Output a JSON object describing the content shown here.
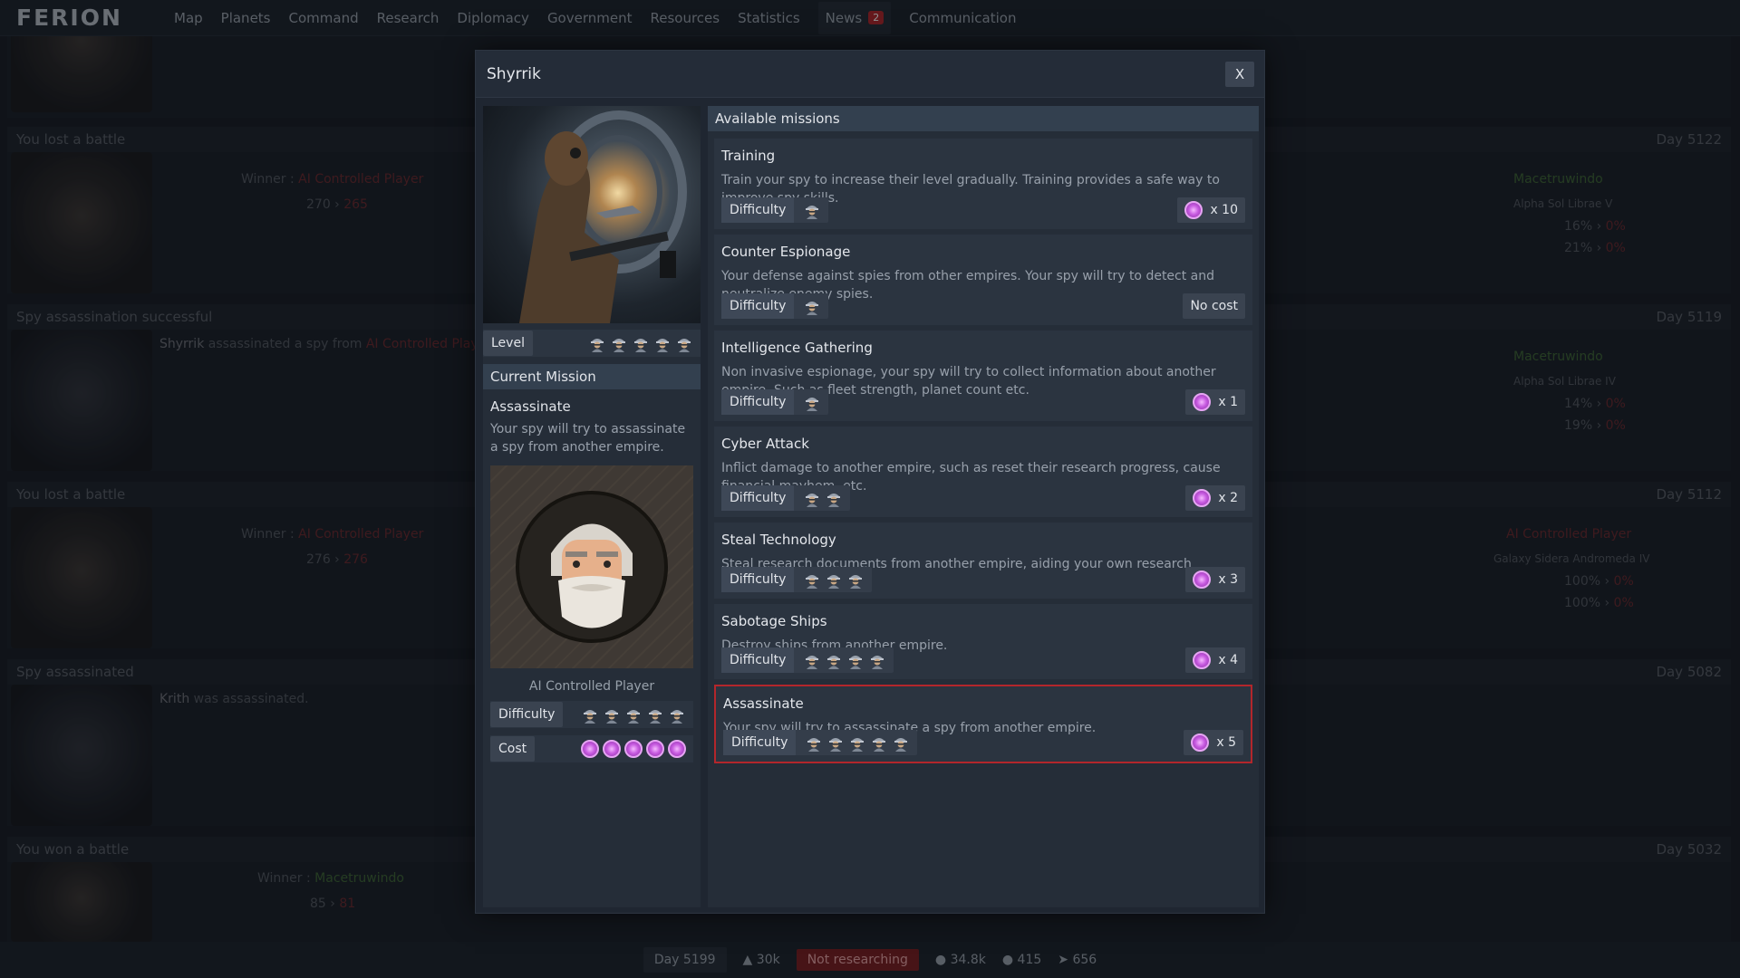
{
  "app": {
    "logo": "FERION"
  },
  "nav": [
    {
      "label": "Map"
    },
    {
      "label": "Planets"
    },
    {
      "label": "Command"
    },
    {
      "label": "Research"
    },
    {
      "label": "Diplomacy"
    },
    {
      "label": "Government"
    },
    {
      "label": "Resources"
    },
    {
      "label": "Statistics"
    },
    {
      "label": "News",
      "badge": "2"
    },
    {
      "label": "Communication"
    }
  ],
  "feed": [
    {
      "header": "You lost a battle",
      "day": "Day 5122",
      "winner_label": "Winner : ",
      "winner": "AI Controlled Player",
      "ships_from": "270",
      "ships_to": "265",
      "right_player": "Macetruwindo",
      "location": "Alpha Sol Librae V",
      "pct1": "16%",
      "pct1b": "0%",
      "pct2": "21%",
      "pct2b": "0%"
    },
    {
      "header": "Spy assassination successful",
      "day": "Day 5119",
      "actor": "Shyrrik",
      "verb": " assassinated a spy from ",
      "target": "AI Controlled Player.",
      "right_player": "Macetruwindo",
      "location": "Alpha Sol Librae IV",
      "pct1": "14%",
      "pct1b": "0%",
      "pct2": "19%",
      "pct2b": "0%"
    },
    {
      "header": "You lost a battle",
      "day": "Day 5112",
      "winner_label": "Winner : ",
      "winner": "AI Controlled Player",
      "ships_from": "276",
      "ships_to": "276",
      "right_player": "AI Controlled Player",
      "location": "Galaxy Sidera Andromeda IV",
      "pct1": "100%",
      "pct1b": "0%",
      "pct2": "100%",
      "pct2b": "0%"
    },
    {
      "header": "Spy assassinated",
      "day": "Day 5082",
      "actor": "Krith",
      "verb": " was assassinated."
    },
    {
      "header": "You won a battle",
      "day": "Day 5032",
      "winner_label": "Winner : ",
      "winner": "Macetruwindo",
      "ships_from": "85",
      "ships_to": "81"
    }
  ],
  "modal": {
    "title": "Shyrrik",
    "close_label": "X",
    "level_label": "Level",
    "level": 5,
    "current_mission_heading": "Current Mission",
    "current_mission": {
      "title": "Assassinate",
      "desc": "Your spy will try to assassinate a spy from another empire.",
      "target": "AI Controlled Player",
      "difficulty_label": "Difficulty",
      "difficulty": 5,
      "cost_label": "Cost",
      "cost": 5
    },
    "missions_heading": "Available missions",
    "missions": [
      {
        "title": "Training",
        "desc": "Train your spy to increase their level gradually. Training provides a safe way to improve spy skills.",
        "difficulty_label": "Difficulty",
        "difficulty": 1,
        "cost": "x 10",
        "has_coin": true
      },
      {
        "title": "Counter Espionage",
        "desc": "Your defense against spies from other empires. Your spy will try to detect and neutralize enemy spies.",
        "difficulty_label": "Difficulty",
        "difficulty": 1,
        "cost": "No cost",
        "has_coin": false
      },
      {
        "title": "Intelligence Gathering",
        "desc": "Non invasive espionage, your spy will try to collect information about another empire. Such as fleet strength, planet count etc.",
        "difficulty_label": "Difficulty",
        "difficulty": 1,
        "cost": "x 1",
        "has_coin": true
      },
      {
        "title": "Cyber Attack",
        "desc": "Inflict damage to another empire, such as reset their research progress, cause financial mayhem, etc.",
        "difficulty_label": "Difficulty",
        "difficulty": 2,
        "cost": "x 2",
        "has_coin": true
      },
      {
        "title": "Steal Technology",
        "desc": "Steal research documents from another empire, aiding your own research progress.",
        "difficulty_label": "Difficulty",
        "difficulty": 3,
        "cost": "x 3",
        "has_coin": true
      },
      {
        "title": "Sabotage Ships",
        "desc": "Destroy ships from another empire.",
        "difficulty_label": "Difficulty",
        "difficulty": 4,
        "cost": "x 4",
        "has_coin": true
      },
      {
        "title": "Assassinate",
        "desc": "Your spy will try to assassinate a spy from another empire.",
        "difficulty_label": "Difficulty",
        "difficulty": 5,
        "cost": "x 5",
        "has_coin": true,
        "selected": true
      }
    ]
  },
  "bottombar": {
    "day": "Day 5199",
    "population": "30k",
    "research": "Not researching",
    "credits": "34.8k",
    "planets": "415",
    "ships": "656"
  },
  "colors": {
    "accent_red": "#b3262b",
    "win_green": "#6cc24a",
    "enemy_red": "#d2383a",
    "coin_purple": "#c75be0"
  }
}
